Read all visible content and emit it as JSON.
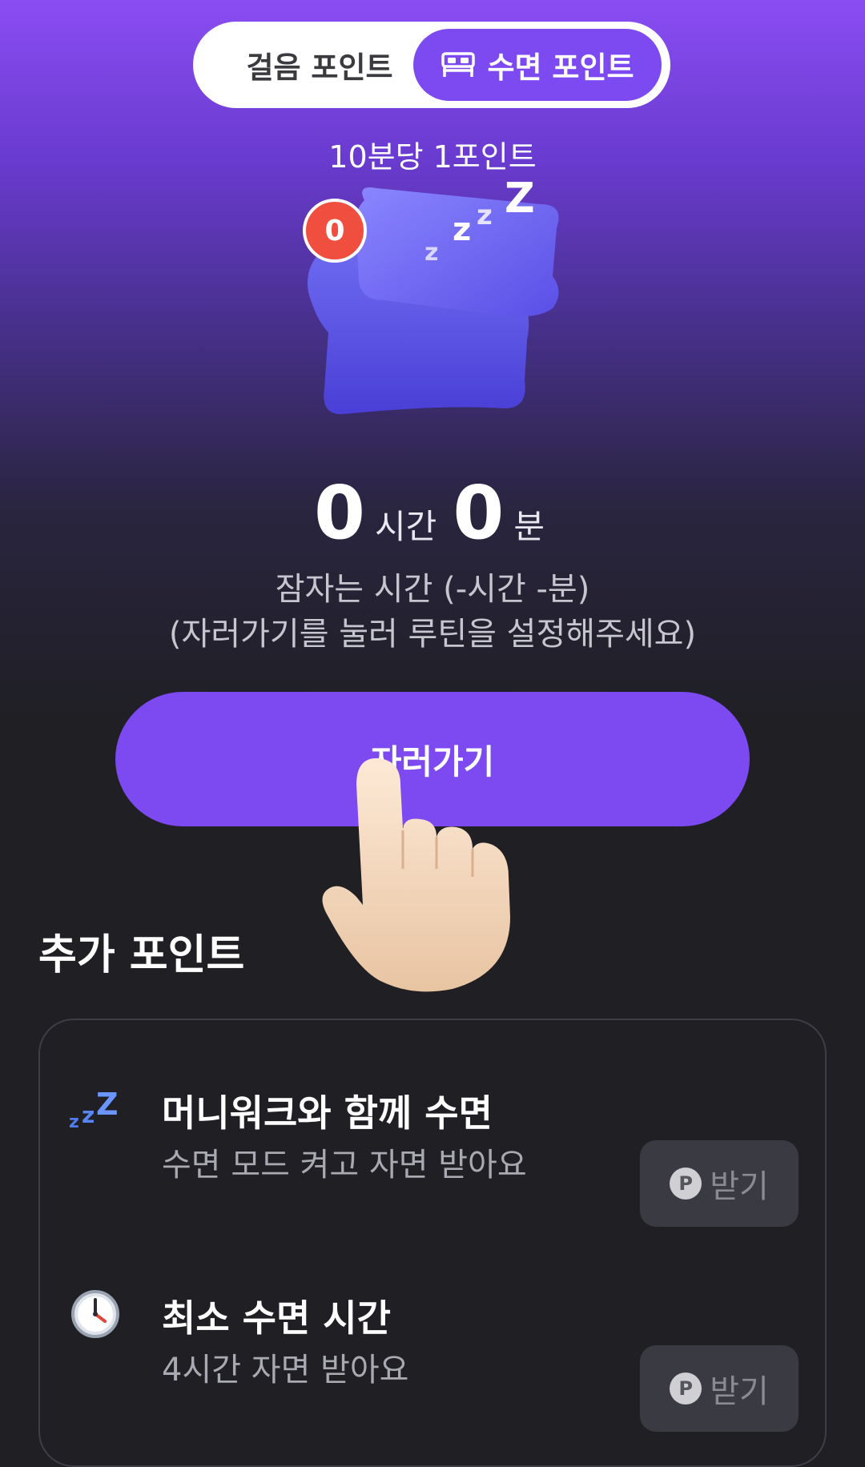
{
  "tabs": {
    "walk_label": "걸음 포인트",
    "sleep_label": "수면 포인트"
  },
  "rate_text": "10분당 1포인트",
  "badge_count": "0",
  "sleep_time": {
    "hours": "0",
    "hours_unit": "시간",
    "minutes": "0",
    "minutes_unit": "분"
  },
  "description": {
    "line1": "잠자는 시간 (-시간 -분)",
    "line2": "(자러가기를 눌러 루틴을 설정해주세요)"
  },
  "sleep_button_label": "자러가기",
  "extra_section": {
    "title": "추가 포인트",
    "items": [
      {
        "icon": "zzz-icon",
        "title": "머니워크와 함께 수면",
        "subtitle": "수면 모드 켜고 자면 받아요",
        "button_label": "받기",
        "coin": "P"
      },
      {
        "icon": "clock-icon",
        "title": "최소 수면 시간",
        "subtitle": "4시간 자면 받아요",
        "button_label": "받기",
        "coin": "P"
      }
    ]
  },
  "colors": {
    "accent": "#7c4af0",
    "badge": "#f04e3e",
    "background": "#1f1f24"
  }
}
